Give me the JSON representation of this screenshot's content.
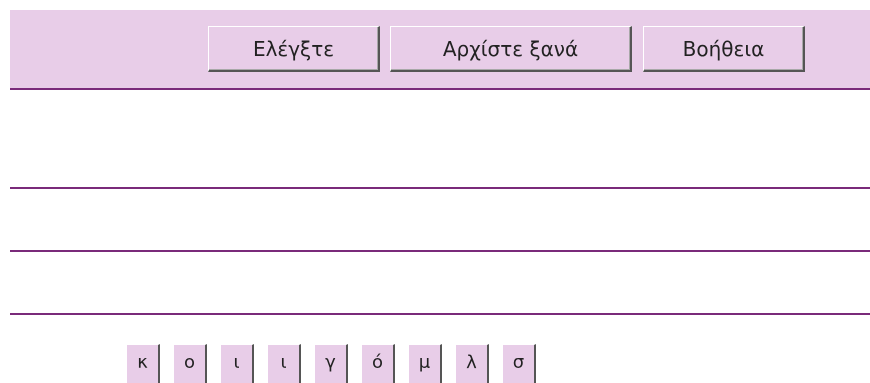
{
  "toolbar": {
    "check_label": "Ελέγξτε",
    "restart_label": "Αρχίστε ξανά",
    "help_label": "Βοήθεια"
  },
  "answer_lines": [
    "",
    "",
    ""
  ],
  "letter_tiles": [
    "κ",
    "ο",
    "ι",
    "ι",
    "γ",
    "ό",
    "μ",
    "λ",
    "σ"
  ],
  "colors": {
    "toolbar_bg": "#e8cde8",
    "line": "#7a2a7a",
    "tile_bg": "#e8cde8"
  }
}
